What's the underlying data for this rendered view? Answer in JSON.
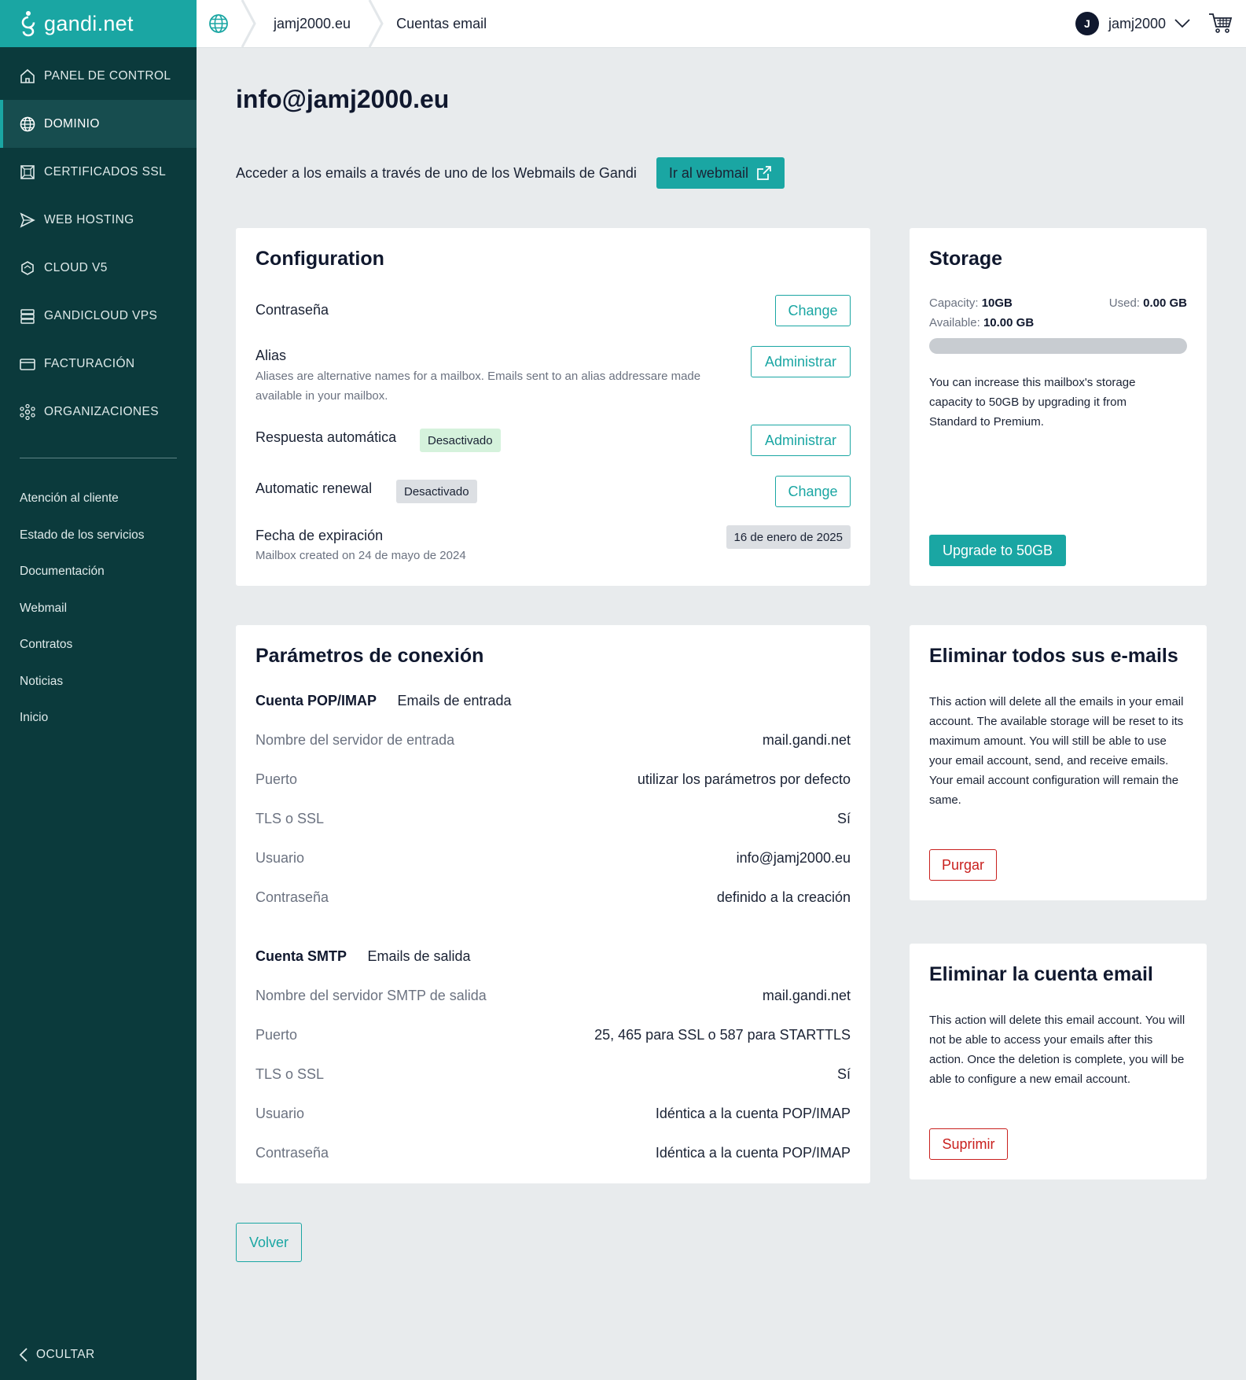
{
  "brand": {
    "name": "gandi.net"
  },
  "sidebar": {
    "items": [
      {
        "label": "PANEL DE CONTROL",
        "icon": "home-icon"
      },
      {
        "label": "DOMINIO",
        "icon": "globe-icon"
      },
      {
        "label": "CERTIFICADOS SSL",
        "icon": "certificate-icon"
      },
      {
        "label": "WEB HOSTING",
        "icon": "paper-plane-icon"
      },
      {
        "label": "CLOUD V5",
        "icon": "cloud-hex-icon"
      },
      {
        "label": "GANDICLOUD VPS",
        "icon": "server-icon"
      },
      {
        "label": "FACTURACIÓN",
        "icon": "card-icon"
      },
      {
        "label": "ORGANIZACIONES",
        "icon": "organization-icon"
      }
    ],
    "links": [
      "Atención al cliente",
      "Estado de los servicios",
      "Documentación",
      "Webmail",
      "Contratos",
      "Noticias",
      "Inicio"
    ],
    "hide_label": "OCULTAR"
  },
  "topbar": {
    "crumbs": [
      "jamj2000.eu",
      "Cuentas email"
    ],
    "user_initial": "J",
    "username": "jamj2000"
  },
  "page": {
    "title": "info@jamj2000.eu",
    "webmail_text": "Acceder a los emails a través de uno de los Webmails de Gandi",
    "webmail_button": "Ir al webmail"
  },
  "configuration": {
    "title": "Configuration",
    "password_label": "Contraseña",
    "password_button": "Change",
    "alias_label": "Alias",
    "alias_desc": "Aliases are alternative names for a mailbox. Emails sent to an alias addressare made available in your mailbox.",
    "alias_button": "Administrar",
    "autoreply_label": "Respuesta automática",
    "autoreply_status": "Desactivado",
    "autoreply_button": "Administrar",
    "renewal_label": "Automatic renewal",
    "renewal_status": "Desactivado",
    "renewal_button": "Change",
    "expiry_label": "Fecha de expiración",
    "expiry_sub": "Mailbox created on 24 de mayo de 2024",
    "expiry_date": "16 de enero de 2025"
  },
  "storage": {
    "title": "Storage",
    "capacity_label": "Capacity:",
    "capacity_value": "10GB",
    "used_label": "Used:",
    "used_value": "0.00 GB",
    "available_label": "Available:",
    "available_value": "10.00 GB",
    "used_fraction": 0.0,
    "info": "You can increase this mailbox's storage capacity to 50GB by upgrading it from Standard to Premium.",
    "upgrade_button": "Upgrade to 50GB"
  },
  "connection": {
    "title": "Parámetros de conexión",
    "pop": {
      "heading": "Cuenta POP/IMAP",
      "subheading": "Emails de entrada",
      "rows": [
        {
          "k": "Nombre del servidor de entrada",
          "v": "mail.gandi.net"
        },
        {
          "k": "Puerto",
          "v": "utilizar los parámetros por defecto"
        },
        {
          "k": "TLS o SSL",
          "v": "Sí"
        },
        {
          "k": "Usuario",
          "v": "info@jamj2000.eu"
        },
        {
          "k": "Contraseña",
          "v": "definido a la creación"
        }
      ]
    },
    "smtp": {
      "heading": "Cuenta SMTP",
      "subheading": "Emails de salida",
      "rows": [
        {
          "k": "Nombre del servidor SMTP de salida",
          "v": "mail.gandi.net"
        },
        {
          "k": "Puerto",
          "v": "25, 465 para SSL o 587 para STARTTLS"
        },
        {
          "k": "TLS o SSL",
          "v": "Sí"
        },
        {
          "k": "Usuario",
          "v": "Idéntica a la cuenta POP/IMAP"
        },
        {
          "k": "Contraseña",
          "v": "Idéntica a la cuenta POP/IMAP"
        }
      ]
    }
  },
  "purge": {
    "title": "Eliminar todos sus e-mails",
    "text": "This action will delete all the emails in your email account. The available storage will be reset to its maximum amount. You will still be able to use your email account, send, and receive emails. Your email account configuration will remain the same.",
    "button": "Purgar"
  },
  "delete": {
    "title": "Eliminar la cuenta email",
    "text": "This action will delete this email account. You will not be able to access your emails after this action. Once the deletion is complete, you will be able to configure a new email account.",
    "button": "Suprimir"
  },
  "back_button": "Volver",
  "colors": {
    "teal": "#1aa6a3",
    "sidebar": "#0b3a3c",
    "danger": "#c9201e"
  }
}
